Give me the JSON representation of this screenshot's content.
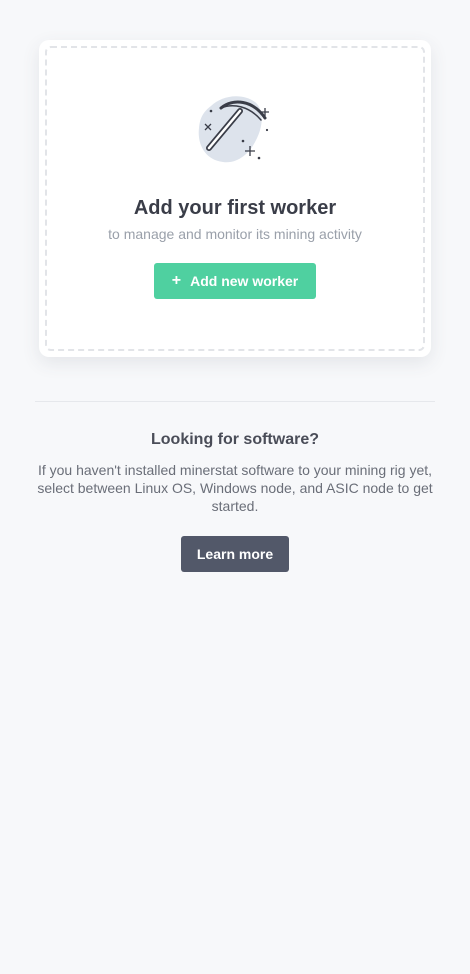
{
  "empty_state": {
    "illustration_icon": "pickaxe-icon",
    "title": "Add your first worker",
    "subtitle": "to manage and monitor its mining activity",
    "add_button": {
      "icon": "+",
      "label": "Add new worker"
    }
  },
  "software": {
    "title": "Looking for software?",
    "description": "If you haven't installed minerstat software to your mining rig yet, select between Linux OS, Windows node, and ASIC node to get started.",
    "learn_more_label": "Learn more"
  },
  "colors": {
    "accent_green": "#4fd0a0",
    "dark_button": "#525869",
    "background": "#f7f8fa"
  }
}
